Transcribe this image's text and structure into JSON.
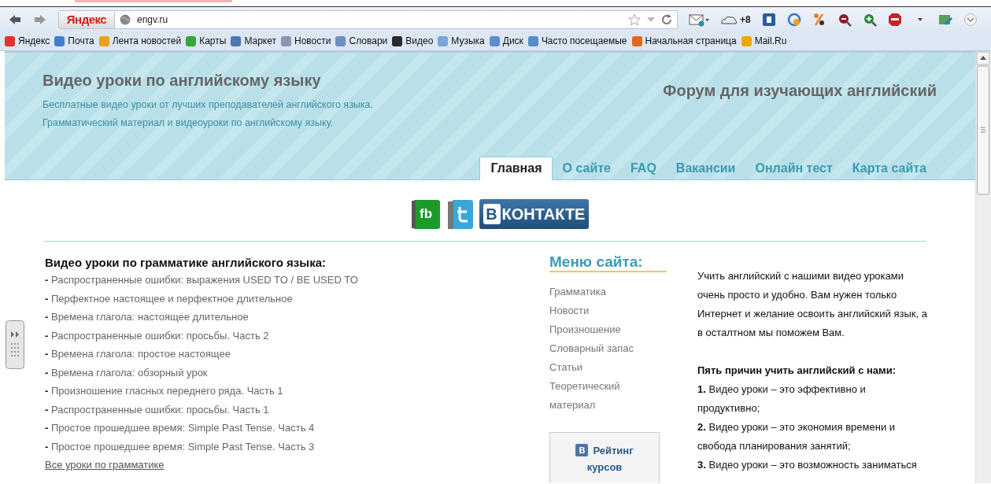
{
  "browser": {
    "search_button": "Яндекс",
    "address": "engv.ru",
    "weather_count": "+8"
  },
  "bookmarks": [
    {
      "label": "Яндекс",
      "color": "#e0322a"
    },
    {
      "label": "Почта",
      "color": "#3f7fd0"
    },
    {
      "label": "Лента новостей",
      "color": "#e8a21c"
    },
    {
      "label": "Карты",
      "color": "#3aa53a"
    },
    {
      "label": "Маркет",
      "color": "#4a78b0"
    },
    {
      "label": "Новости",
      "color": "#8a96b4"
    },
    {
      "label": "Словари",
      "color": "#6e8fc0"
    },
    {
      "label": "Видео",
      "color": "#2a2a2a"
    },
    {
      "label": "Музыка",
      "color": "#7aa6d8"
    },
    {
      "label": "Диск",
      "color": "#5c8ed0"
    },
    {
      "label": "Часто посещаемые",
      "color": "#5a8cc8"
    },
    {
      "label": "Начальная страница",
      "color": "#e06a1a"
    },
    {
      "label": "Mail.Ru",
      "color": "#f0a400"
    }
  ],
  "site": {
    "title": "Видео уроки по английскому языку",
    "subtitle": [
      "Бесплатные видео уроки от лучших преподавателей английского языка.",
      "Грамматический материал и видеоуроки по английскому языку."
    ],
    "forum_link": "Форум для изучающих английский",
    "tabs": [
      {
        "label": "Главная",
        "selected": true
      },
      {
        "label": "О сайте",
        "selected": false
      },
      {
        "label": "FAQ",
        "selected": false
      },
      {
        "label": "Вакансии",
        "selected": false
      },
      {
        "label": "Онлайн тест",
        "selected": false
      },
      {
        "label": "Карта сайта",
        "selected": false
      }
    ]
  },
  "social": {
    "fb_label": "fb",
    "vk_letter": "В",
    "vk_label": "КОНТАКТЕ"
  },
  "grammar": {
    "heading": "Видео уроки по грамматике английского языка:",
    "items": [
      "**-** Распространенные ошибки: выражения USED TO / BE USED TO",
      "**-** Перфектное настоящее и перфектное длительное",
      "**-** Времена глагола: настоящее длительное",
      "**-** Распространенные ошибки: просьбы. Часть 2",
      "**-** Времена глагола: простое настоящее",
      "**-** Времена глагола: обзорный урок",
      "**-** Произношение гласных переднего ряда. Часть 1",
      "**-** Распространенные ошибки: просьбы. Часть 1",
      "**-** Простое прошедшее время: Simple Past Tense. Часть 4",
      "**-** Простое прошедшее время: Simple Past Tense. Часть 3"
    ],
    "all_link": "Все уроки по грамматике"
  },
  "menu": {
    "heading": "Меню сайта:",
    "items": [
      "Грамматика",
      "Новости",
      "Произношение",
      "Словарный запас",
      "Статьи",
      "Теоретический материал"
    ]
  },
  "rating": {
    "letter": "В",
    "text": "Рейтинг курсов"
  },
  "about": {
    "intro": "Учить английский с нашими видео уроками очень просто и удобно. Вам нужен только Интернет и желание освоить английский язык, а в осталтном мы поможем Вам.",
    "reasons_heading": "Пять причин учить английский с нами:",
    "reasons": [
      "**1.** Видео уроки – это эффективно и продуктивно;",
      "**2.** Видео уроки – это экономия времени и свобода планирования занятий;",
      "**3.** Видео уроки – это возможность заниматься"
    ]
  }
}
